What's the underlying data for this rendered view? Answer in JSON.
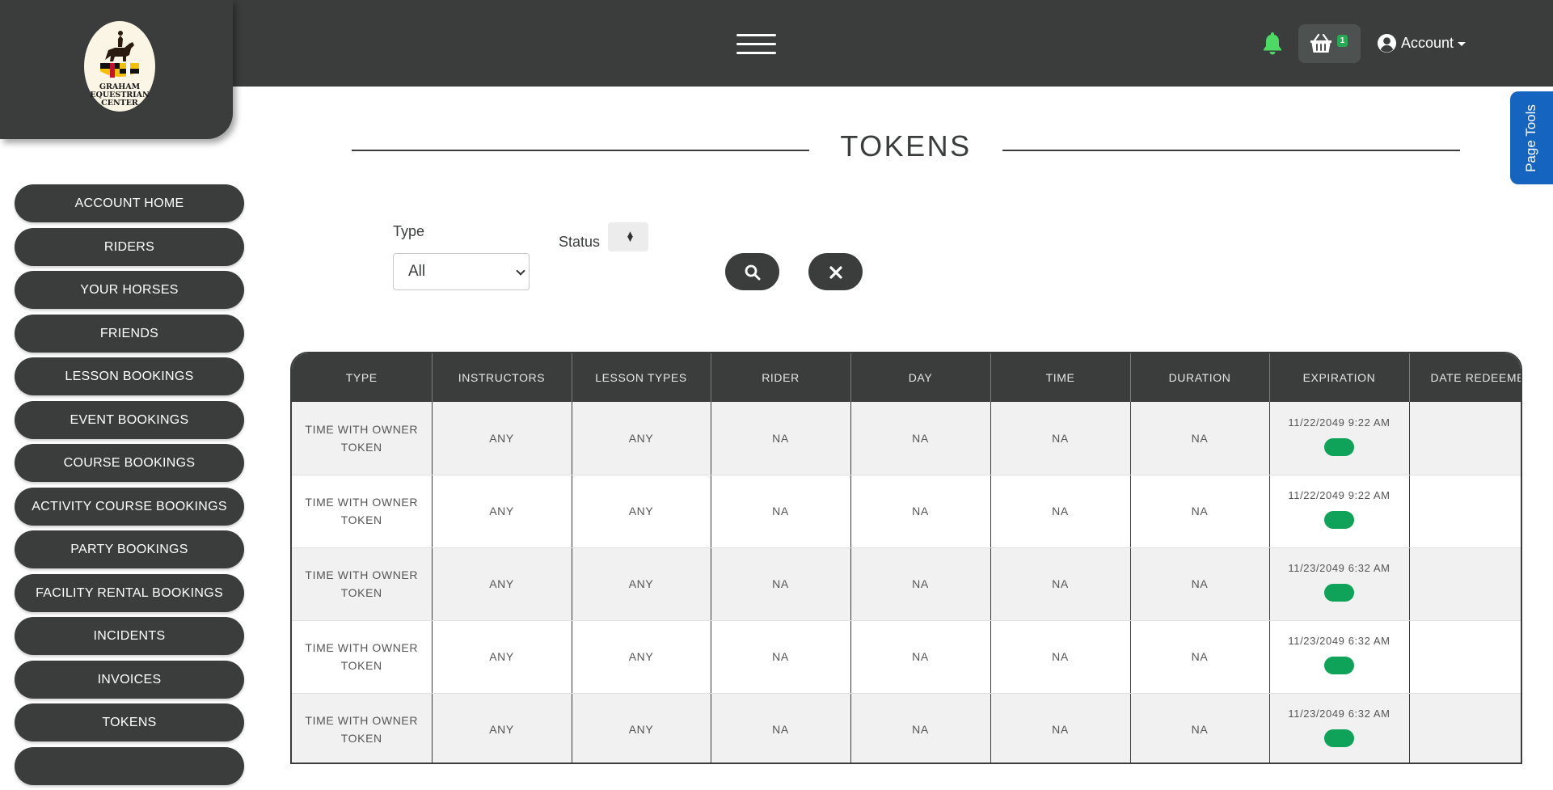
{
  "header": {
    "cart_count": "1",
    "account_label": "Account"
  },
  "logo": {
    "line1": "GRAHAM",
    "line2": "EQUESTRIAN",
    "line3": "CENTER"
  },
  "sidebar": {
    "items": [
      {
        "label": "ACCOUNT HOME"
      },
      {
        "label": "RIDERS"
      },
      {
        "label": "YOUR HORSES"
      },
      {
        "label": "FRIENDS"
      },
      {
        "label": "LESSON BOOKINGS"
      },
      {
        "label": "EVENT BOOKINGS"
      },
      {
        "label": "COURSE BOOKINGS"
      },
      {
        "label": "ACTIVITY COURSE BOOKINGS"
      },
      {
        "label": "PARTY BOOKINGS"
      },
      {
        "label": "FACILITY RENTAL BOOKINGS"
      },
      {
        "label": "INCIDENTS"
      },
      {
        "label": "INVOICES"
      },
      {
        "label": "TOKENS"
      }
    ]
  },
  "page": {
    "title": "TOKENS",
    "page_tools": "Page Tools"
  },
  "filters": {
    "type_label": "Type",
    "type_value": "All",
    "status_label": "Status"
  },
  "table": {
    "headers": [
      "TYPE",
      "INSTRUCTORS",
      "LESSON TYPES",
      "RIDER",
      "DAY",
      "TIME",
      "DURATION",
      "EXPIRATION",
      "DATE REDEEMED"
    ],
    "rows": [
      {
        "type": "TIME WITH OWNER TOKEN",
        "instructors": "ANY",
        "lesson_types": "ANY",
        "rider": "NA",
        "day": "NA",
        "time": "NA",
        "duration": "NA",
        "expiration": "11/22/2049 9:22 AM",
        "date_redeemed": ""
      },
      {
        "type": "TIME WITH OWNER TOKEN",
        "instructors": "ANY",
        "lesson_types": "ANY",
        "rider": "NA",
        "day": "NA",
        "time": "NA",
        "duration": "NA",
        "expiration": "11/22/2049 9:22 AM",
        "date_redeemed": ""
      },
      {
        "type": "TIME WITH OWNER TOKEN",
        "instructors": "ANY",
        "lesson_types": "ANY",
        "rider": "NA",
        "day": "NA",
        "time": "NA",
        "duration": "NA",
        "expiration": "11/23/2049 6:32 AM",
        "date_redeemed": ""
      },
      {
        "type": "TIME WITH OWNER TOKEN",
        "instructors": "ANY",
        "lesson_types": "ANY",
        "rider": "NA",
        "day": "NA",
        "time": "NA",
        "duration": "NA",
        "expiration": "11/23/2049 6:32 AM",
        "date_redeemed": ""
      },
      {
        "type": "TIME WITH OWNER TOKEN",
        "instructors": "ANY",
        "lesson_types": "ANY",
        "rider": "NA",
        "day": "NA",
        "time": "NA",
        "duration": "NA",
        "expiration": "11/23/2049 6:32 AM",
        "date_redeemed": ""
      }
    ]
  },
  "icons": {
    "bell": "bell-icon",
    "cart": "basket-icon",
    "account": "user-circle-icon",
    "search": "search-icon",
    "clear": "close-icon"
  },
  "colors": {
    "primary_dark": "#3a3d3c",
    "page_tools_blue": "#1565c0",
    "active_green": "#0fa35a",
    "bell_green": "#4cd964"
  }
}
